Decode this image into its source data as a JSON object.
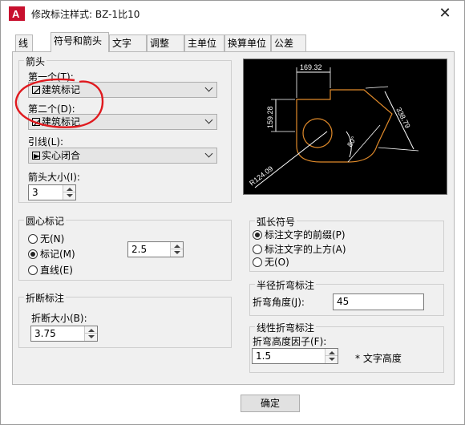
{
  "window": {
    "title": "修改标注样式: BZ-1比10",
    "app_icon_text": "A",
    "close_label": "✕"
  },
  "tabs": [
    {
      "label": "线"
    },
    {
      "label": "符号和箭头"
    },
    {
      "label": "文字"
    },
    {
      "label": "调整"
    },
    {
      "label": "主单位"
    },
    {
      "label": "换算单位"
    },
    {
      "label": "公差"
    }
  ],
  "arrows": {
    "group_title": "箭头",
    "first_label": "第一个(T):",
    "first_value": "建筑标记",
    "second_label": "第二个(D):",
    "second_value": "建筑标记",
    "leader_label": "引线(L):",
    "leader_value": "实心闭合",
    "size_label": "箭头大小(I):",
    "size_value": "3"
  },
  "preview": {
    "dim_top": "169.32",
    "dim_left": "159.28",
    "dim_right": "338.79",
    "dim_angle": "80°",
    "dim_radius": "R124.09"
  },
  "center_mark": {
    "group_title": "圆心标记",
    "options": [
      "无(N)",
      "标记(M)",
      "直线(E)"
    ],
    "selected": "标记(M)",
    "size_value": "2.5"
  },
  "arc_symbol": {
    "group_title": "弧长符号",
    "options": [
      "标注文字的前缀(P)",
      "标注文字的上方(A)",
      "无(O)"
    ],
    "selected": "标注文字的前缀(P)"
  },
  "break": {
    "group_title": "折断标注",
    "size_label": "折断大小(B):",
    "size_value": "3.75"
  },
  "radius_jog": {
    "group_title": "半径折弯标注",
    "angle_label": "折弯角度(J):",
    "angle_value": "45"
  },
  "linear_jog": {
    "group_title": "线性折弯标注",
    "height_label": "折弯高度因子(F):",
    "height_value": "1.5",
    "suffix": "* 文字高度"
  },
  "footer": {
    "ok_label": "确定"
  },
  "colors": {
    "preview_bg": "#000000",
    "preview_line": "#ffffff",
    "preview_part": "#e08a2a",
    "annotation": "#e0191e"
  }
}
